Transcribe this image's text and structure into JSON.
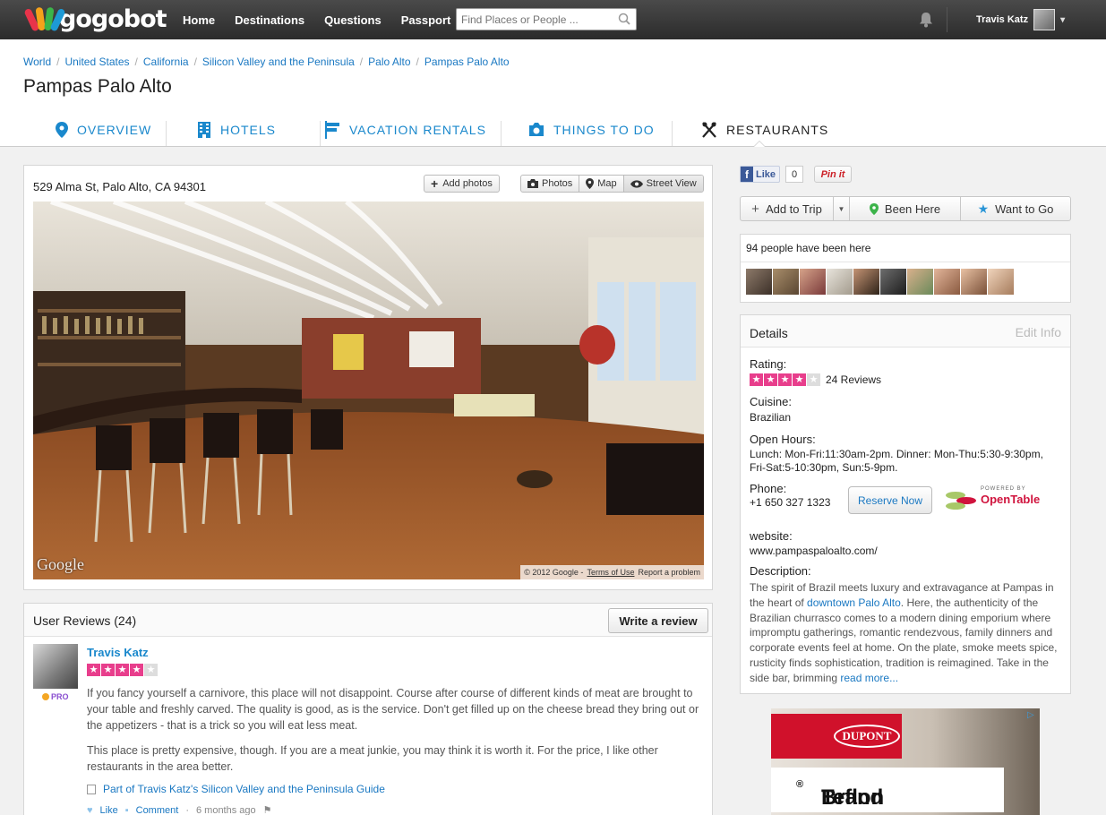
{
  "nav": {
    "logo": "gogobot",
    "links": [
      "Home",
      "Destinations",
      "Questions",
      "Passport"
    ],
    "search_placeholder": "Find Places or People ...",
    "user_name": "Travis Katz"
  },
  "breadcrumbs": [
    "World",
    "United States",
    "California",
    "Silicon Valley and the Peninsula",
    "Palo Alto",
    "Pampas Palo Alto"
  ],
  "page_title": "Pampas Palo Alto",
  "tabs": [
    {
      "label": "OVERVIEW",
      "icon": "map-pin-icon"
    },
    {
      "label": "HOTELS",
      "icon": "hotel-icon"
    },
    {
      "label": "VACATION RENTALS",
      "icon": "flag-icon"
    },
    {
      "label": "THINGS TO DO",
      "icon": "camera-icon"
    },
    {
      "label": "RESTAURANTS",
      "icon": "fork-knife-icon",
      "active": true
    }
  ],
  "photo": {
    "address": "529 Alma St, Palo Alto, CA 94301",
    "add_photos": "Add photos",
    "views": [
      "Photos",
      "Map",
      "Street View"
    ],
    "active_view": "Street View",
    "watermark": "Google",
    "copyright": "© 2012 Google -",
    "terms": "Terms of Use",
    "report": "Report a problem"
  },
  "reviews": {
    "title": "User Reviews (24)",
    "write_label": "Write a review",
    "items": [
      {
        "author": "Travis Katz",
        "badge": "PRO",
        "rating": 4,
        "paragraphs": [
          "If you fancy yourself a carnivore, this place will not disappoint. Course after course of different kinds of meat are brought to your table and freshly carved. The quality is good, as is the service. Don't get filled up on the cheese bread they bring out or the appetizers - that is a trick so you will eat less meat.",
          "This place is pretty expensive, though. If you are a meat junkie, you may think it is worth it. For the price, I like other restaurants in the area better."
        ],
        "guide": "Part of Travis Katz's Silicon Valley and the Peninsula Guide",
        "like": "Like",
        "comment": "Comment",
        "time": "6 months ago"
      }
    ]
  },
  "social": {
    "like_label": "Like",
    "like_count": "0",
    "pin_label": "Pin it"
  },
  "trip_actions": {
    "add_to_trip": "Add to Trip",
    "been_here": "Been Here",
    "want_to_go": "Want to Go"
  },
  "been_here": {
    "text": "94 people have been here",
    "faces": 10
  },
  "details": {
    "title": "Details",
    "edit": "Edit Info",
    "rating_label": "Rating:",
    "rating": 4,
    "review_count": "24 Reviews",
    "cuisine_label": "Cuisine:",
    "cuisine": "Brazilian",
    "hours_label": "Open Hours:",
    "hours_line1": "Lunch: Mon-Fri:11:30am-2pm. Dinner: Mon-Thu:5:30-9:30pm,",
    "hours_line2": "Fri-Sat:5-10:30pm, Sun:5-9pm.",
    "phone_label": "Phone:",
    "phone": "+1 650 327 1323",
    "reserve": "Reserve Now",
    "powered_by": "POWERED BY",
    "opentable": "OpenTable",
    "website_label": "website:",
    "website": "www.pampaspaloalto.com/",
    "description_label": "Description:",
    "description_before": "The spirit of Brazil meets luxury and extravagance at Pampas in the heart of ",
    "description_link": "downtown Palo Alto",
    "description_after": ". Here, the authenticity of the Brazilian churrasco comes to a modern dining emporium where impromptu gatherings, romantic rendezvous, family dinners and corporate events feel at home. On the plate, smoke meets spice, rusticity finds sophistication, tradition is reimagined. Take in the side bar, brimming ",
    "read_more": "read more..."
  },
  "ad": {
    "brand": "DUPONT",
    "product": "Teflon",
    "product_suffix": "Brand",
    "reg": "®"
  },
  "colors": {
    "accent": "#1a88cc",
    "star": "#e83e8c",
    "nav_bg": "#333333"
  }
}
